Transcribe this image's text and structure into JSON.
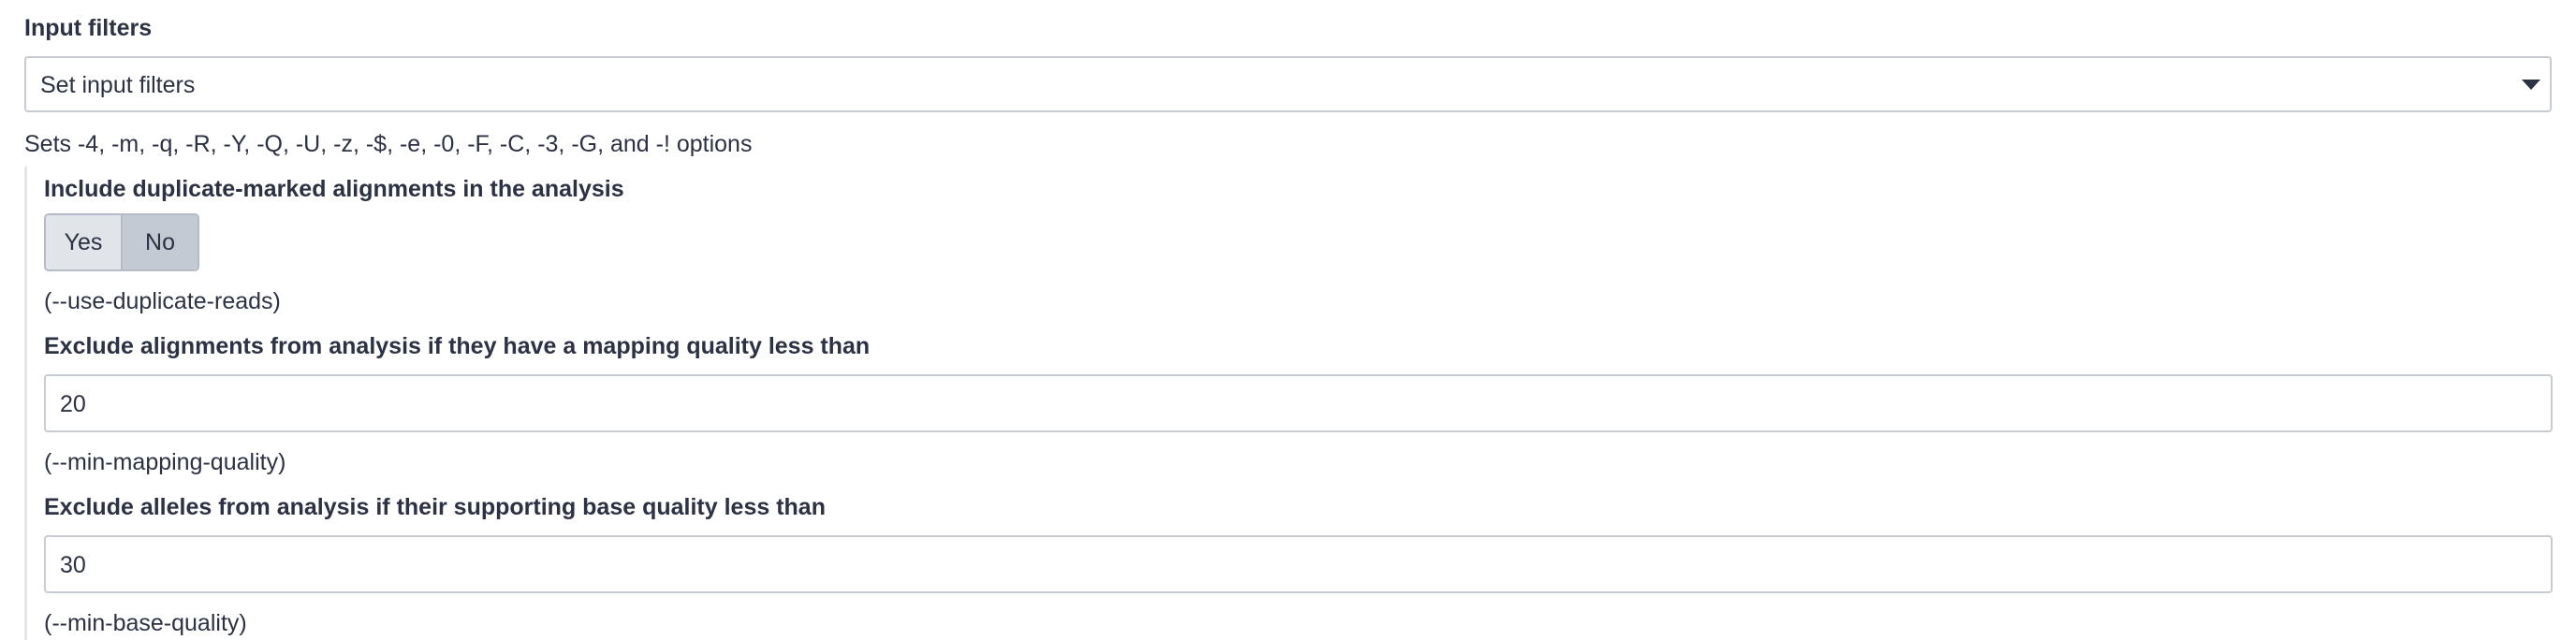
{
  "section": {
    "label": "Input filters",
    "select_value": "Set input filters",
    "help": "Sets -4, -m, -q, -R, -Y, -Q, -U, -z, -$, -e, -0, -F, -C, -3, -G, and -! options"
  },
  "fields": [
    {
      "label": "Include duplicate-marked alignments in the analysis",
      "type": "toggle",
      "options": [
        "Yes",
        "No"
      ],
      "selected": "No",
      "help": "(--use-duplicate-reads)"
    },
    {
      "label": "Exclude alignments from analysis if they have a mapping quality less than",
      "type": "text",
      "value": "20",
      "help": "(--min-mapping-quality)"
    },
    {
      "label": "Exclude alleles from analysis if their supporting base quality less than",
      "type": "text",
      "value": "30",
      "help": "(--min-base-quality)"
    }
  ],
  "colors": {
    "text": "#2c3143",
    "border": "#c8ccd3",
    "toggle_selected": "#c3cad3",
    "toggle_unselected": "#e1e5ea"
  },
  "icons": {
    "select_caret": "caret-down-icon"
  }
}
